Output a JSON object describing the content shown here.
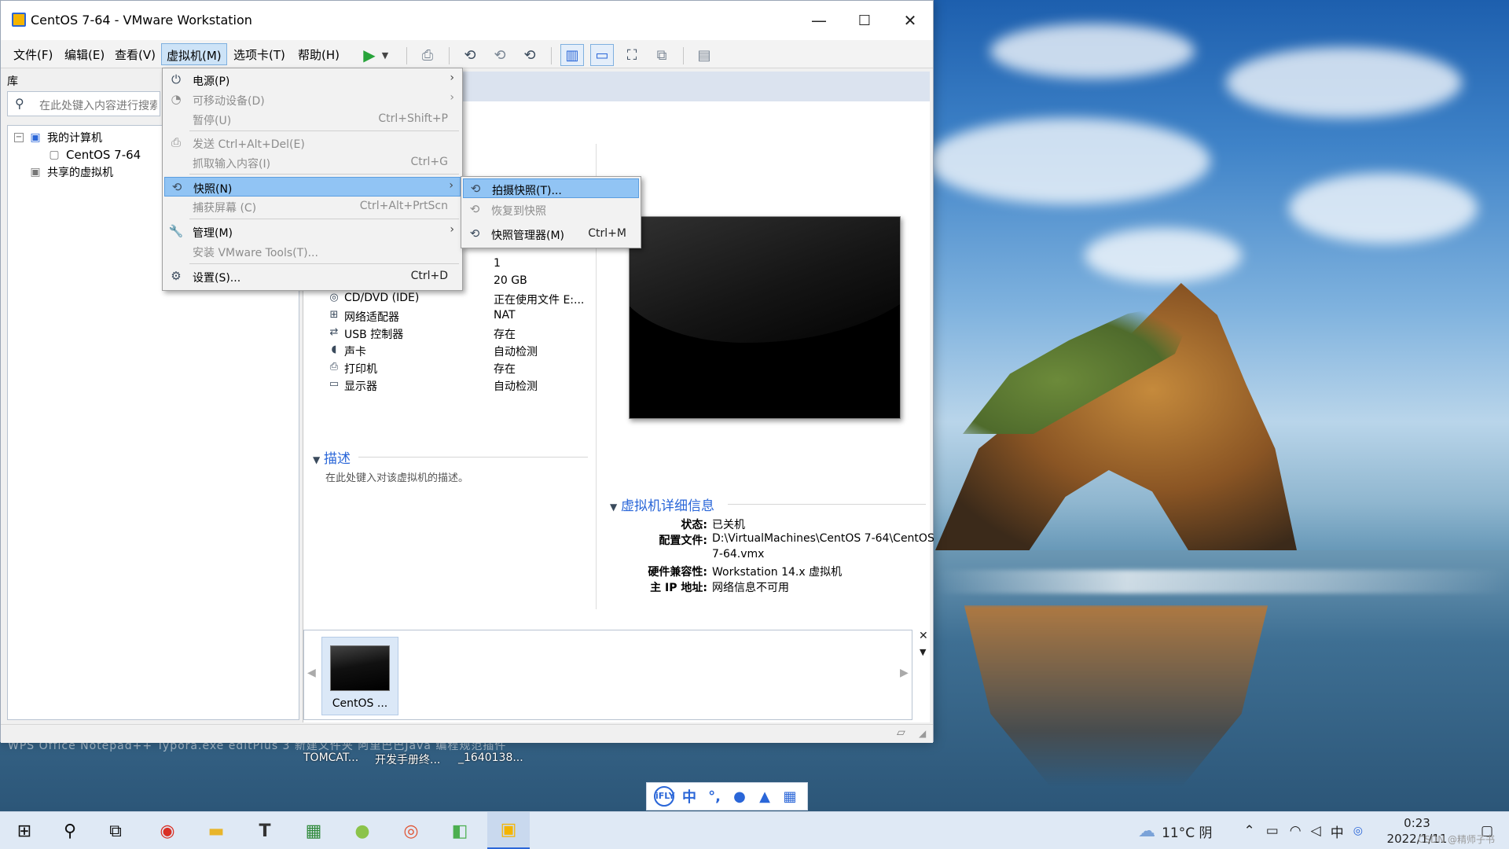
{
  "window": {
    "title": "CentOS 7-64 - VMware Workstation",
    "min_glyph": "—",
    "max_glyph": "☐",
    "close_glyph": "✕"
  },
  "menubar": [
    "文件(F)",
    "编辑(E)",
    "查看(V)",
    "虚拟机(M)",
    "选项卡(T)",
    "帮助(H)"
  ],
  "library": {
    "label": "库",
    "search_placeholder": "在此处键入内容进行搜索",
    "tree": {
      "root": "我的计算机",
      "vm": "CentOS 7-64",
      "shared": "共享的虚拟机"
    }
  },
  "vm_menu": {
    "items": [
      {
        "label": "电源(P)",
        "shortcut": "",
        "submenu": true,
        "disabled": false,
        "icon": "power-icon"
      },
      {
        "label": "可移动设备(D)",
        "shortcut": "",
        "submenu": true,
        "disabled": true,
        "icon": "removable-device-icon"
      },
      {
        "label": "暂停(U)",
        "shortcut": "Ctrl+Shift+P",
        "submenu": false,
        "disabled": true,
        "icon": ""
      },
      {
        "label": "发送 Ctrl+Alt+Del(E)",
        "shortcut": "",
        "submenu": false,
        "disabled": true,
        "icon": "keyboard-icon"
      },
      {
        "label": "抓取输入内容(I)",
        "shortcut": "Ctrl+G",
        "submenu": false,
        "disabled": true,
        "icon": ""
      },
      {
        "label": "快照(N)",
        "shortcut": "",
        "submenu": true,
        "disabled": false,
        "icon": "snapshot-icon"
      },
      {
        "label": "捕获屏幕 (C)",
        "shortcut": "Ctrl+Alt+PrtScn",
        "submenu": false,
        "disabled": true,
        "icon": ""
      },
      {
        "label": "管理(M)",
        "shortcut": "",
        "submenu": true,
        "disabled": false,
        "icon": "wrench-icon"
      },
      {
        "label": "安装 VMware Tools(T)...",
        "shortcut": "",
        "submenu": false,
        "disabled": true,
        "icon": ""
      },
      {
        "label": "设置(S)...",
        "shortcut": "Ctrl+D",
        "submenu": false,
        "disabled": false,
        "icon": "settings-icon"
      }
    ]
  },
  "snapshot_menu": {
    "items": [
      {
        "label": "拍摄快照(T)...",
        "shortcut": "",
        "disabled": false,
        "icon": "take-snapshot-icon"
      },
      {
        "label": "恢复到快照",
        "shortcut": "",
        "disabled": true,
        "icon": "revert-snapshot-icon"
      },
      {
        "label": "快照管理器(M)",
        "shortcut": "Ctrl+M",
        "disabled": false,
        "icon": "snapshot-manager-icon"
      }
    ]
  },
  "hardware": [
    {
      "name": "",
      "value": "1"
    },
    {
      "name": "硬盘 (SCSI)",
      "value": "20 GB"
    },
    {
      "name": "CD/DVD (IDE)",
      "value": "正在使用文件 E:..."
    },
    {
      "name": "网络适配器",
      "value": "NAT"
    },
    {
      "name": "USB 控制器",
      "value": "存在"
    },
    {
      "name": "声卡",
      "value": "自动检测"
    },
    {
      "name": "打印机",
      "value": "存在"
    },
    {
      "name": "显示器",
      "value": "自动检测"
    }
  ],
  "description": {
    "heading": "描述",
    "placeholder": "在此处键入对该虚拟机的描述。"
  },
  "details": {
    "heading": "虚拟机详细信息",
    "rows": [
      {
        "key": "状态:",
        "value": "已关机"
      },
      {
        "key": "配置文件:",
        "value": "D:\\VirtualMachines\\CentOS 7-64\\CentOS"
      },
      {
        "key": "",
        "value": "7-64.vmx"
      },
      {
        "key": "硬件兼容性:",
        "value": "Workstation 14.x 虚拟机"
      },
      {
        "key": "主 IP 地址:",
        "value": "网络信息不可用"
      }
    ]
  },
  "thumbnail": {
    "caption": "CentOS ..."
  },
  "desktop": {
    "labels_top": "WPS Office   Notepad++   Typora.exe   editPlus 3   新建文件夹   阿里巴巴Java 编程规范插件   ",
    "labels": [
      "TOMCAT...",
      "开发手册终...",
      "_1640138..."
    ]
  },
  "ime": [
    "iFLY",
    "中",
    "°,",
    "🎤",
    "👤",
    "▦"
  ],
  "taskbar": {
    "weather": "11°C 阴",
    "time": "0:23",
    "date": "2022/1/11",
    "watermark": "CSDN @精师子书"
  },
  "colors": {
    "accent": "#2a66d8",
    "menu_highlight": "#91c4f4",
    "play_green": "#27a33a"
  }
}
